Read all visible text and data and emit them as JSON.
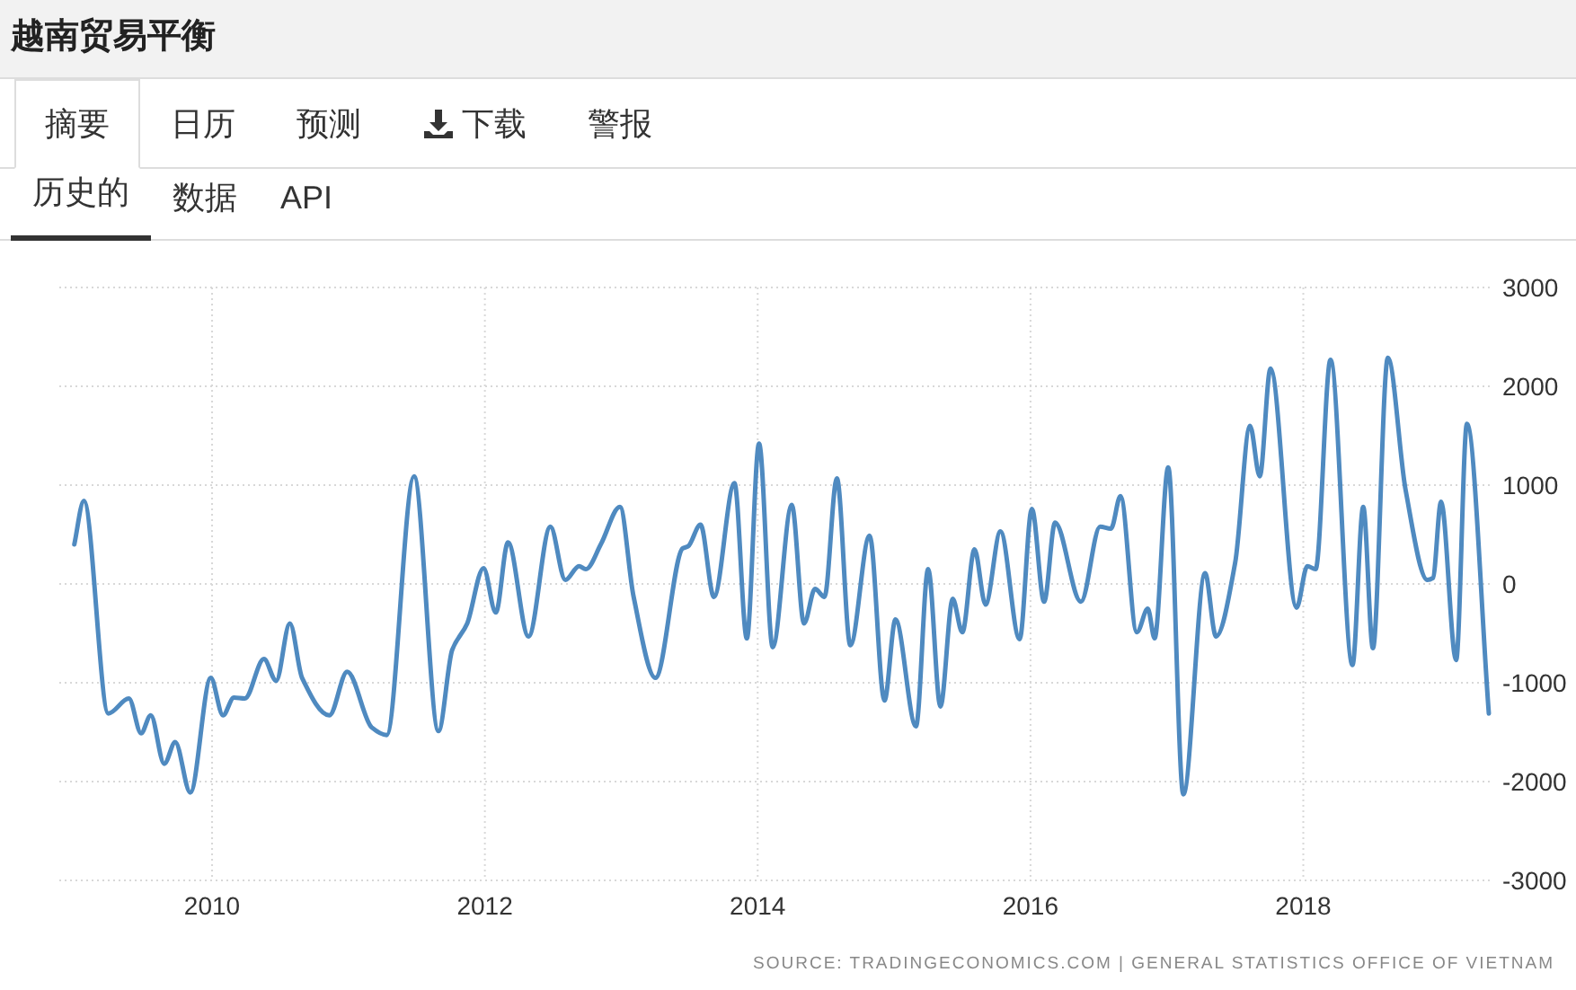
{
  "title": "越南贸易平衡",
  "tabs": [
    {
      "label": "摘要",
      "selected": true,
      "kind": "plain"
    },
    {
      "label": "日历",
      "selected": false,
      "kind": "plain"
    },
    {
      "label": "预测",
      "selected": false,
      "kind": "plain"
    },
    {
      "label": "下载",
      "selected": false,
      "kind": "download"
    },
    {
      "label": "警报",
      "selected": false,
      "kind": "plain"
    }
  ],
  "subtabs": [
    {
      "label": "历史的",
      "selected": true
    },
    {
      "label": "数据",
      "selected": false
    },
    {
      "label": "API",
      "selected": false
    }
  ],
  "chart": {
    "chart_data": {
      "type": "line",
      "grid": true,
      "xlim": [
        2008.88,
        2019.38
      ],
      "ylim": [
        -3000,
        3000
      ],
      "xticks": [
        2010,
        2012,
        2014,
        2016,
        2018
      ],
      "yticks": [
        -3000,
        -2000,
        -1000,
        0,
        1000,
        2000,
        3000
      ],
      "x": [
        2008.99,
        2009.06,
        2009.24,
        2009.39,
        2009.48,
        2009.55,
        2009.65,
        2009.73,
        2009.84,
        2009.99,
        2010.08,
        2010.16,
        2010.24,
        2010.38,
        2010.47,
        2010.57,
        2010.66,
        2010.86,
        2010.99,
        2011.17,
        2011.28,
        2011.48,
        2011.66,
        2011.76,
        2011.87,
        2011.99,
        2012.08,
        2012.17,
        2012.32,
        2012.48,
        2012.59,
        2012.69,
        2012.74,
        2012.85,
        2012.99,
        2013.09,
        2013.25,
        2013.45,
        2013.49,
        2013.58,
        2013.68,
        2013.83,
        2013.92,
        2014.01,
        2014.11,
        2014.25,
        2014.34,
        2014.42,
        2014.49,
        2014.58,
        2014.68,
        2014.82,
        2014.93,
        2015.01,
        2015.16,
        2015.25,
        2015.34,
        2015.43,
        2015.5,
        2015.59,
        2015.67,
        2015.78,
        2015.92,
        2016.01,
        2016.1,
        2016.18,
        2016.37,
        2016.51,
        2016.59,
        2016.66,
        2016.78,
        2016.86,
        2016.91,
        2017.01,
        2017.12,
        2017.28,
        2017.36,
        2017.5,
        2017.61,
        2017.68,
        2017.76,
        2017.95,
        2018.03,
        2018.09,
        2018.2,
        2018.36,
        2018.44,
        2018.51,
        2018.62,
        2018.75,
        2018.91,
        2018.95,
        2019.01,
        2019.12,
        2019.2,
        2019.36
      ],
      "series": [
        {
          "color": "#4f8ac0",
          "values": [
            400,
            840,
            -1310,
            -1160,
            -1510,
            -1330,
            -1820,
            -1600,
            -2110,
            -950,
            -1330,
            -1150,
            -1160,
            -760,
            -980,
            -400,
            -950,
            -1330,
            -890,
            -1450,
            -1530,
            1090,
            -1490,
            -670,
            -400,
            160,
            -290,
            420,
            -530,
            580,
            40,
            180,
            150,
            400,
            780,
            -130,
            -950,
            360,
            380,
            600,
            -130,
            1020,
            -550,
            1420,
            -640,
            800,
            -400,
            -50,
            -130,
            1070,
            -620,
            490,
            -1180,
            -360,
            -1440,
            150,
            -1240,
            -150,
            -490,
            350,
            -210,
            530,
            -560,
            760,
            -180,
            620,
            -180,
            580,
            560,
            890,
            -490,
            -250,
            -550,
            1180,
            -2130,
            110,
            -530,
            210,
            1600,
            1090,
            2180,
            -240,
            180,
            150,
            2270,
            -820,
            780,
            -650,
            2290,
            950,
            40,
            60,
            830,
            -770,
            1620,
            -1310
          ]
        }
      ]
    },
    "source": "SOURCE: TRADINGECONOMICS.COM | GENERAL STATISTICS OFFICE OF VIETNAM"
  }
}
